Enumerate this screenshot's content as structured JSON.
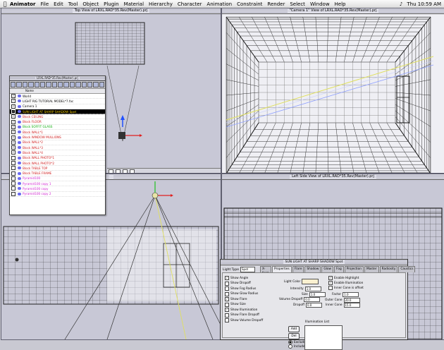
{
  "menubar": {
    "apple": "",
    "app": "Animator",
    "items": [
      "File",
      "Edit",
      "Tool",
      "Object",
      "Plugin",
      "Material",
      "Hierarchy",
      "Character",
      "Animation",
      "Constraint",
      "Render",
      "Select",
      "Window",
      "Help"
    ],
    "clock": "Thu 10:59 AM"
  },
  "viewports": {
    "top": {
      "title": "Top View of LRXL.RAD*35.Rev(Master).prj"
    },
    "camera": {
      "title": "\"Camera 1\" View of LRXL.RAD*35.Rev(Master).prj"
    },
    "front": {
      "title": ""
    },
    "left": {
      "title": "Left Side View of LRXL.RAD*35.Rev(Master).prj"
    }
  },
  "scene_browser": {
    "title": "LRXL.RAD*35.Rev(Master).prj",
    "column_header": "Name",
    "items": [
      {
        "label": "World",
        "color": "#000000",
        "checked": true,
        "selected": false
      },
      {
        "label": "LIGHT RIG TUTORIAL MODEL*7.fac",
        "color": "#000000",
        "checked": true,
        "selected": false
      },
      {
        "label": "Camera 1",
        "color": "#000000",
        "checked": true,
        "selected": false
      },
      {
        "label": "SUN LIGHT AT SHARP SHADOW Spot",
        "color": "#ffd700",
        "checked": true,
        "selected": true
      },
      {
        "label": "Block CEILING",
        "color": "#d02020",
        "checked": true,
        "selected": false
      },
      {
        "label": "Block FLOOR",
        "color": "#d02020",
        "checked": true,
        "selected": false
      },
      {
        "label": "Block SOFFIT GLASS",
        "color": "#10b010",
        "checked": true,
        "selected": false
      },
      {
        "label": "Block WALL*1",
        "color": "#d02020",
        "checked": true,
        "selected": false
      },
      {
        "label": "Block WINDOW MULLIONS",
        "color": "#d02020",
        "checked": true,
        "selected": false
      },
      {
        "label": "Block WALL*2",
        "color": "#d02020",
        "checked": true,
        "selected": false
      },
      {
        "label": "Block WALL*3",
        "color": "#d02020",
        "checked": true,
        "selected": false
      },
      {
        "label": "Block WALL*4",
        "color": "#d02020",
        "checked": true,
        "selected": false
      },
      {
        "label": "Block WALL PHOTO*1",
        "color": "#d02020",
        "checked": false,
        "selected": false
      },
      {
        "label": "Block WALL PHOTO*2",
        "color": "#d02020",
        "checked": false,
        "selected": false
      },
      {
        "label": "Block TABLE TOP",
        "color": "#d02020",
        "checked": false,
        "selected": false
      },
      {
        "label": "Block TABLE FRAME",
        "color": "#d02020",
        "checked": false,
        "selected": false
      },
      {
        "label": "Pyramid100",
        "color": "#d020d0",
        "checked": false,
        "selected": false
      },
      {
        "label": "Pyramid100 copy 1",
        "color": "#d020d0",
        "checked": false,
        "selected": false
      },
      {
        "label": "Pyramid100 copy",
        "color": "#d020d0",
        "checked": false,
        "selected": false
      },
      {
        "label": "Pyramid100 copy 2",
        "color": "#d020d0",
        "checked": false,
        "selected": false
      }
    ]
  },
  "light_dialog": {
    "title": "SUN LIGHT AT SHARP SHADOW Spot",
    "light_type_label": "Light Type",
    "light_type_value": "Spot",
    "tabs": [
      "X-form",
      "Properties",
      "Flare",
      "Shadow",
      "Glow",
      "Fog",
      "Projection",
      "Master",
      "Radiosity",
      "Caustics"
    ],
    "active_tab": "Properties",
    "options_left": [
      {
        "label": "Show Angle",
        "checked": true
      },
      {
        "label": "Show Dropoff",
        "checked": false
      },
      {
        "label": "Show Fog Radius",
        "checked": false
      },
      {
        "label": "Show Glow Radius",
        "checked": false
      },
      {
        "label": "Show Flare",
        "checked": true
      },
      {
        "label": "Show Size",
        "checked": false
      },
      {
        "label": "Show Illumination",
        "checked": true
      },
      {
        "label": "Show Flare Dropoff",
        "checked": false
      },
      {
        "label": "Show Volume Dropoff",
        "checked": false
      }
    ],
    "light_color_label": "Light Color",
    "fields_mid": [
      {
        "label": "Intensity",
        "value": "1.0"
      },
      {
        "label": "Size",
        "value": "1.0"
      },
      {
        "label": "Volume Dropoff",
        "value": "0.0"
      },
      {
        "label": "Dropoff",
        "value": "0.0"
      }
    ],
    "options_right": [
      {
        "label": "Enable Highlight",
        "checked": true
      },
      {
        "label": "Enable Illumination",
        "checked": true
      },
      {
        "label": "Inner Cone is offset",
        "checked": false
      }
    ],
    "fields_right": [
      {
        "label": "Factor",
        "value": "1.0"
      },
      {
        "label": "Outer Cone",
        "value": "20.0"
      },
      {
        "label": "Inner Cone",
        "value": "15.0"
      }
    ],
    "illumination_label": "Illumination List",
    "add_label": "Add",
    "del_label": "Del",
    "radio_include": "Exclude",
    "radio_exclude": "Include"
  }
}
